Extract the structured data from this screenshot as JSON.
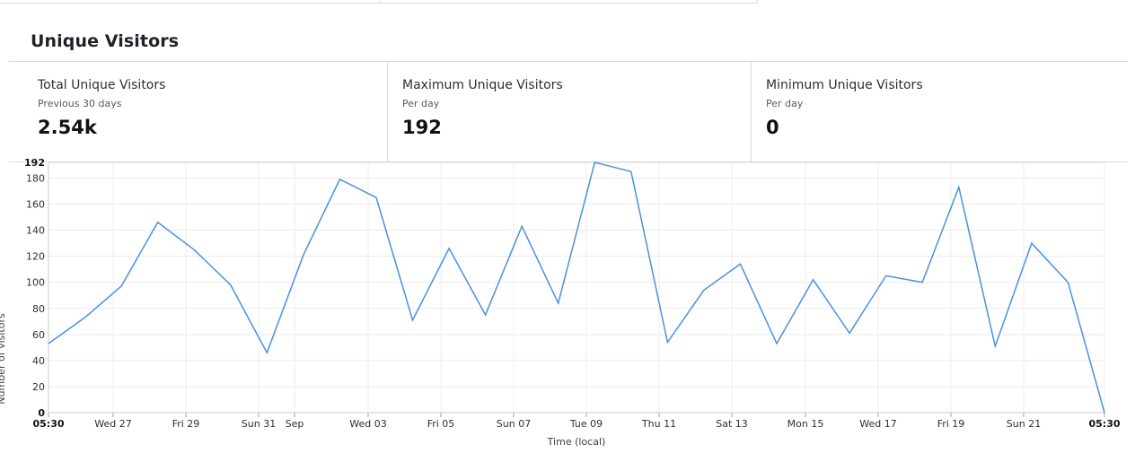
{
  "panel": {
    "title": "Unique Visitors"
  },
  "stats": [
    {
      "label": "Total Unique Visitors",
      "sub": "Previous 30 days",
      "value": "2.54k"
    },
    {
      "label": "Maximum Unique Visitors",
      "sub": "Per day",
      "value": "192"
    },
    {
      "label": "Minimum Unique Visitors",
      "sub": "Per day",
      "value": "0"
    }
  ],
  "chart_data": {
    "type": "line",
    "title": "",
    "xlabel": "Time (local)",
    "ylabel": "Number of visitors",
    "ylim": [
      0,
      192
    ],
    "y_ticks": [
      0,
      20,
      40,
      60,
      80,
      100,
      120,
      140,
      160,
      180,
      192
    ],
    "x_ticks": [
      "05:30",
      "Wed 27",
      "Fri 29",
      "Sun 31",
      "Sep",
      "Wed 03",
      "Fri 05",
      "Sun 07",
      "Tue 09",
      "Thu 11",
      "Sat 13",
      "Mon 15",
      "Wed 17",
      "Fri 19",
      "Sun 21",
      "05:30"
    ],
    "grid": true,
    "line_color": "#4a90e2",
    "series": [
      {
        "values": [
          53,
          73,
          97,
          146,
          125,
          98,
          46,
          121,
          179,
          165,
          71,
          126,
          75,
          143,
          84,
          192,
          185,
          54,
          94,
          114,
          53,
          102,
          61,
          105,
          100,
          173,
          51,
          130,
          100,
          0
        ]
      }
    ]
  }
}
